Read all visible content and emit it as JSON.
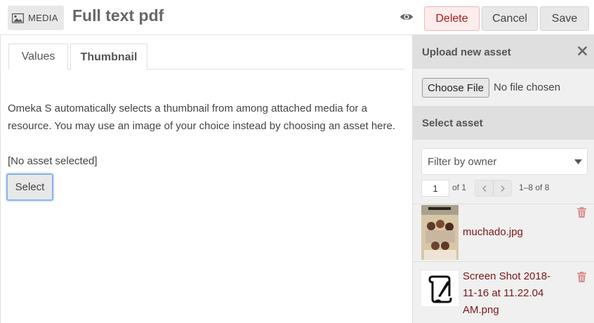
{
  "header": {
    "media_label": "MEDIA",
    "title": "Full text pdf",
    "delete_label": "Delete",
    "cancel_label": "Cancel",
    "save_label": "Save"
  },
  "tabs": [
    {
      "label": "Values",
      "active": false
    },
    {
      "label": "Thumbnail",
      "active": true
    }
  ],
  "thumbnail": {
    "description": "Omeka S automatically selects a thumbnail from among attached media for a resource. You may use an image of your choice instead by choosing an asset here.",
    "status": "[No asset selected]",
    "select_label": "Select"
  },
  "sidebar": {
    "upload_title": "Upload new asset",
    "choose_file_label": "Choose File",
    "no_file_text": "No file chosen",
    "select_title": "Select asset",
    "filter_selected": "Filter by owner",
    "pager": {
      "page": "1",
      "of_text": "of 1",
      "range": "1–8 of 8"
    },
    "assets": [
      {
        "name": "muchado.jpg"
      },
      {
        "name": "Screen Shot 2018-11-16 at 11.22.04 AM.png"
      }
    ]
  },
  "colors": {
    "delete": "#a91919",
    "asset_link": "#7b1519",
    "trash": "#d98a8a",
    "focus_ring": "#8ab4e8"
  },
  "icons": {
    "media": "image-icon",
    "preview": "eye-icon",
    "close": "close-icon",
    "dropdown": "caret-down-icon",
    "delete_asset": "trash-icon"
  }
}
